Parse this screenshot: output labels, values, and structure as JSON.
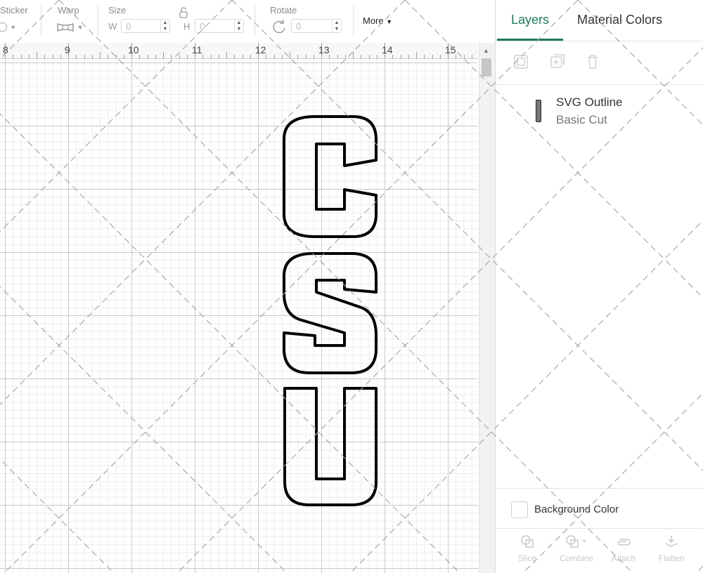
{
  "toolbar": {
    "sticker_label": "Sticker",
    "warp_label": "Warp",
    "size_label": "Size",
    "width_prefix": "W",
    "width_value": "0",
    "height_prefix": "H",
    "height_value": "0",
    "rotate_label": "Rotate",
    "rotate_value": "0",
    "more_label": "More"
  },
  "ruler": {
    "numbers": [
      "8",
      "9",
      "10",
      "11",
      "12",
      "13",
      "14",
      "15"
    ]
  },
  "canvas": {
    "design_letters": [
      "C",
      "S",
      "U"
    ]
  },
  "panel": {
    "tabs": [
      {
        "label": "Layers",
        "active": true
      },
      {
        "label": "Material Colors",
        "active": false
      }
    ],
    "layer": {
      "name": "SVG Outline",
      "operation": "Basic Cut"
    },
    "background_color_label": "Background Color",
    "bottom_tools": [
      {
        "label": "Slice",
        "icon": "slice-icon"
      },
      {
        "label": "Combine",
        "icon": "combine-icon"
      },
      {
        "label": "Attach",
        "icon": "attach-icon"
      },
      {
        "label": "Flatten",
        "icon": "flatten-icon"
      }
    ]
  },
  "colors": {
    "accent": "#1f7a5a",
    "outline": "#000000"
  }
}
